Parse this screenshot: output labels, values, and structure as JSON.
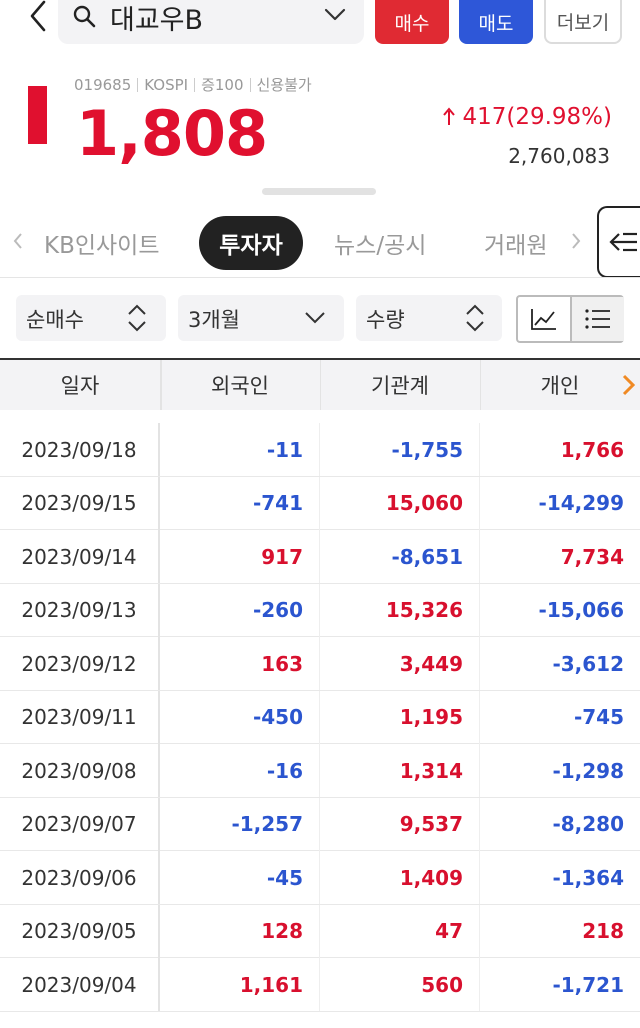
{
  "header": {
    "stock_name": "대교우B",
    "buy_label": "매수",
    "sell_label": "매도",
    "more_label": "더보기"
  },
  "stock": {
    "code": "019685",
    "market": "KOSPI",
    "margin": "증100",
    "credit": "신용불가",
    "price": "1,808",
    "change": "417(29.98%)",
    "volume": "2,760,083"
  },
  "tabs": [
    "KB인사이트",
    "투자자",
    "뉴스/공시",
    "거래원"
  ],
  "filters": {
    "type": "순매수",
    "period": "3개월",
    "unit": "수량"
  },
  "table": {
    "headers": [
      "일자",
      "외국인",
      "기관계",
      "개인"
    ],
    "rows": [
      [
        "2023/09/18",
        "-11",
        "-1,755",
        "1,766"
      ],
      [
        "2023/09/15",
        "-741",
        "15,060",
        "-14,299"
      ],
      [
        "2023/09/14",
        "917",
        "-8,651",
        "7,734"
      ],
      [
        "2023/09/13",
        "-260",
        "15,326",
        "-15,066"
      ],
      [
        "2023/09/12",
        "163",
        "3,449",
        "-3,612"
      ],
      [
        "2023/09/11",
        "-450",
        "1,195",
        "-745"
      ],
      [
        "2023/09/08",
        "-16",
        "1,314",
        "-1,298"
      ],
      [
        "2023/09/07",
        "-1,257",
        "9,537",
        "-8,280"
      ],
      [
        "2023/09/06",
        "-45",
        "1,409",
        "-1,364"
      ],
      [
        "2023/09/05",
        "128",
        "47",
        "218"
      ],
      [
        "2023/09/04",
        "1,161",
        "560",
        "-1,721"
      ]
    ]
  },
  "colors": {
    "up": "#d8102e",
    "down": "#2b55cf",
    "buy": "#e02a33",
    "sell": "#2e57d8"
  }
}
